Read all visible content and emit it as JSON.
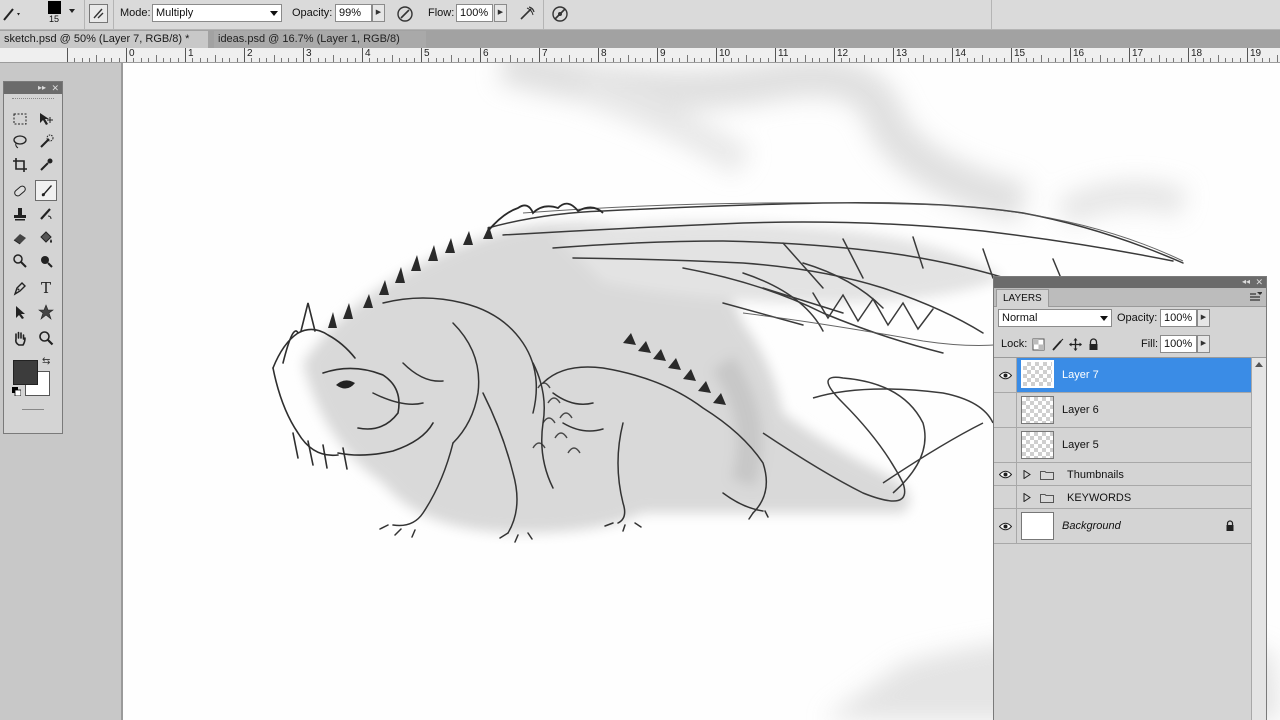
{
  "options_bar": {
    "brush_size": "15",
    "mode_label": "Mode:",
    "mode_value": "Multiply",
    "opacity_label": "Opacity:",
    "opacity_value": "99%",
    "flow_label": "Flow:",
    "flow_value": "100%"
  },
  "document_tabs": [
    {
      "title": "sketch.psd @ 50% (Layer 7, RGB/8) *",
      "active": true
    },
    {
      "title": "ideas.psd @ 16.7% (Layer 1, RGB/8)",
      "active": false
    }
  ],
  "ruler": {
    "marks": [
      "0",
      "1",
      "2",
      "3",
      "4",
      "5",
      "6",
      "7",
      "8",
      "9",
      "10",
      "11",
      "12",
      "13",
      "14",
      "15",
      "16",
      "17",
      "18",
      "19"
    ]
  },
  "colors": {
    "foreground": "#3c3c3c",
    "background": "#ffffff",
    "selection": "#3a8ce6"
  },
  "tools": [
    {
      "icon": "rectangular-marquee-icon"
    },
    {
      "icon": "move-icon"
    },
    {
      "icon": "lasso-icon"
    },
    {
      "icon": "quick-selection-icon"
    },
    {
      "icon": "crop-icon"
    },
    {
      "icon": "eyedropper-icon"
    },
    {
      "icon": "spot-healing-icon"
    },
    {
      "icon": "brush-icon",
      "selected": true
    },
    {
      "icon": "clone-stamp-icon"
    },
    {
      "icon": "history-brush-icon"
    },
    {
      "icon": "eraser-icon"
    },
    {
      "icon": "paint-bucket-icon"
    },
    {
      "icon": "dodge-icon"
    },
    {
      "icon": "burn-icon"
    },
    {
      "icon": "pen-icon"
    },
    {
      "icon": "type-icon",
      "glyph": "T"
    },
    {
      "icon": "path-selection-icon"
    },
    {
      "icon": "custom-shape-icon"
    },
    {
      "icon": "hand-icon"
    },
    {
      "icon": "zoom-icon"
    }
  ],
  "layers_panel": {
    "tab_label": "LAYERS",
    "blend_mode": "Normal",
    "opacity_label": "Opacity:",
    "opacity_value": "100%",
    "lock_label": "Lock:",
    "fill_label": "Fill:",
    "fill_value": "100%",
    "layers": [
      {
        "name": "Layer 7",
        "visible": true,
        "selected": true,
        "type": "layer"
      },
      {
        "name": "Layer 6",
        "visible": false,
        "type": "layer"
      },
      {
        "name": "Layer 5",
        "visible": false,
        "type": "layer"
      },
      {
        "name": "Thumbnails",
        "visible": true,
        "type": "group"
      },
      {
        "name": "KEYWORDS",
        "visible": false,
        "type": "group"
      },
      {
        "name": "Background",
        "visible": true,
        "type": "background",
        "locked": true
      }
    ]
  }
}
